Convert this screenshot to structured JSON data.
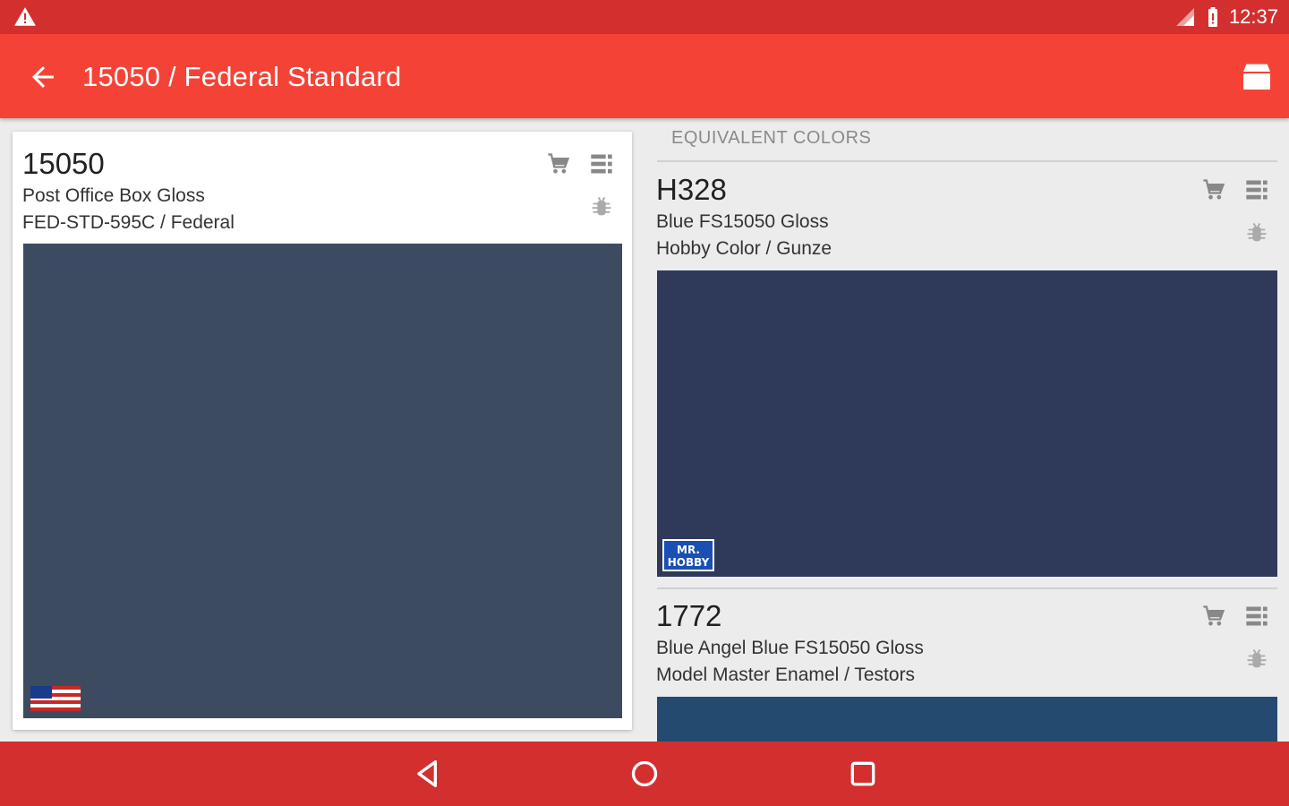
{
  "status_bar": {
    "time": "12:37",
    "icons": [
      "warning-icon",
      "signal-icon",
      "battery-icon"
    ]
  },
  "app_bar": {
    "title": "15050 / Federal Standard",
    "icons": [
      "back-arrow-icon",
      "store-icon"
    ]
  },
  "main_color": {
    "code": "15050",
    "name": "Post Office Box Gloss",
    "reference": "FED-STD-595C / Federal",
    "swatch_color": "#3d4b60",
    "badge": "us-flag-icon",
    "icons": [
      "cart-icon",
      "list-icon",
      "bug-icon"
    ]
  },
  "equivalents": {
    "header": "EQUIVALENT COLORS",
    "items": [
      {
        "code": "H328",
        "name": "Blue FS15050 Gloss",
        "brand": "Hobby Color / Gunze",
        "swatch_color": "#2f3a5a",
        "badge": "mr-hobby-logo",
        "badge_text": "MR. HOBBY"
      },
      {
        "code": "1772",
        "name": "Blue Angel Blue FS15050 Gloss",
        "brand": "Model Master Enamel / Testors",
        "swatch_color": "#244a70"
      }
    ]
  },
  "nav_bar": {
    "icons": [
      "back-triangle-icon",
      "home-circle-icon",
      "recents-square-icon"
    ]
  },
  "colors": {
    "status_bar": "#d32f2f",
    "app_bar": "#f44336",
    "nav_bar": "#d32f2f",
    "background": "#ececec"
  }
}
